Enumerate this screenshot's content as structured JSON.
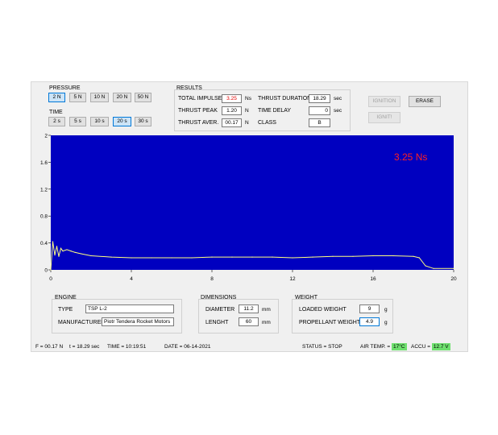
{
  "pressure": {
    "title": "PRESSURE",
    "buttons": [
      "2 N",
      "5 N",
      "10 N",
      "20 N",
      "50 N"
    ],
    "selected": "2 N"
  },
  "time": {
    "title": "TIME",
    "buttons": [
      "2 s",
      "5 s",
      "10 s",
      "20 s",
      "30 s"
    ],
    "selected": "20 s"
  },
  "results": {
    "title": "RESULTS",
    "total_impulse_label": "TOTAL IMPULSE",
    "total_impulse_value": "3.25",
    "total_impulse_unit": "Ns",
    "thrust_peak_label": "THRUST PEAK",
    "thrust_peak_value": "1.20",
    "thrust_peak_unit": "N",
    "thrust_aver_label": "THRUST AVER.",
    "thrust_aver_value": "00.17",
    "thrust_aver_unit": "N",
    "thrust_duration_label": "THRUST DURATION",
    "thrust_duration_value": "18.29",
    "thrust_duration_unit": "sec",
    "time_delay_label": "TIME DELAY",
    "time_delay_value": "0",
    "time_delay_unit": "sec",
    "class_label": "CLASS",
    "class_value": "B"
  },
  "actions": {
    "ignition": "IGNITION",
    "erase": "ERASE",
    "ignit": "IGNIT!"
  },
  "chart_data": {
    "type": "line",
    "annotation": "3.25 Ns",
    "annotation_color": "#ff2020",
    "background_color": "#0000c0",
    "line_color": "#ffff80",
    "x_ticks": [
      "0",
      "4",
      "8",
      "12",
      "16",
      "20"
    ],
    "y_ticks": [
      "2",
      "1.6",
      "1.2",
      "0.8",
      "0.4",
      "0"
    ],
    "xlim": [
      0,
      20
    ],
    "ylim": [
      0,
      2
    ],
    "series": [
      {
        "x": [
          0,
          0.1,
          0.2,
          0.3,
          0.4,
          0.5,
          0.6,
          0.8,
          1.0,
          1.2,
          1.5,
          2.0,
          3.0,
          4.0,
          5.0,
          6.0,
          7.0,
          8.0,
          9.0,
          10.0,
          11.0,
          12.0,
          13.0,
          14.0,
          15.0,
          16.0,
          17.0,
          18.0,
          18.29,
          18.6,
          19.0,
          20.0
        ],
        "y": [
          0,
          0.42,
          0.22,
          0.35,
          0.2,
          0.32,
          0.28,
          0.3,
          0.28,
          0.26,
          0.24,
          0.21,
          0.19,
          0.18,
          0.18,
          0.18,
          0.18,
          0.19,
          0.19,
          0.19,
          0.19,
          0.18,
          0.19,
          0.2,
          0.2,
          0.21,
          0.21,
          0.2,
          0.18,
          0.06,
          0.02,
          0.02
        ]
      }
    ]
  },
  "engine": {
    "title": "ENGINE",
    "type_label": "TYPE",
    "type_value": "TSP L-2",
    "manufacturer_label": "MANUFACTURER",
    "manufacturer_value": "Piotr Tendera Rocket Motors"
  },
  "dimensions": {
    "title": "DIMENSIONS",
    "diameter_label": "DIAMETER",
    "diameter_value": "11.2",
    "diameter_unit": "mm",
    "length_label": "LENGHT",
    "length_value": "60",
    "length_unit": "mm"
  },
  "weight": {
    "title": "WEIGHT",
    "loaded_label": "LOADED WEIGHT",
    "loaded_value": "9",
    "loaded_unit": "g",
    "propellant_label": "PROPELLANT WEIGHT",
    "propellant_value": "4.9",
    "propellant_unit": "g"
  },
  "status_bar": {
    "force": "F = 00.17 N",
    "t": "t = 18.29 sec",
    "time": "TIME = 10:19:51",
    "date": "DATE = 06-14-2021",
    "status": "STATUS = STOP",
    "air_temp_label": "AIR TEMP. =",
    "air_temp_value": "17°C",
    "accu_label": "ACCU =",
    "accu_value": "12.7 V",
    "badge_color": "#6ee06e"
  }
}
